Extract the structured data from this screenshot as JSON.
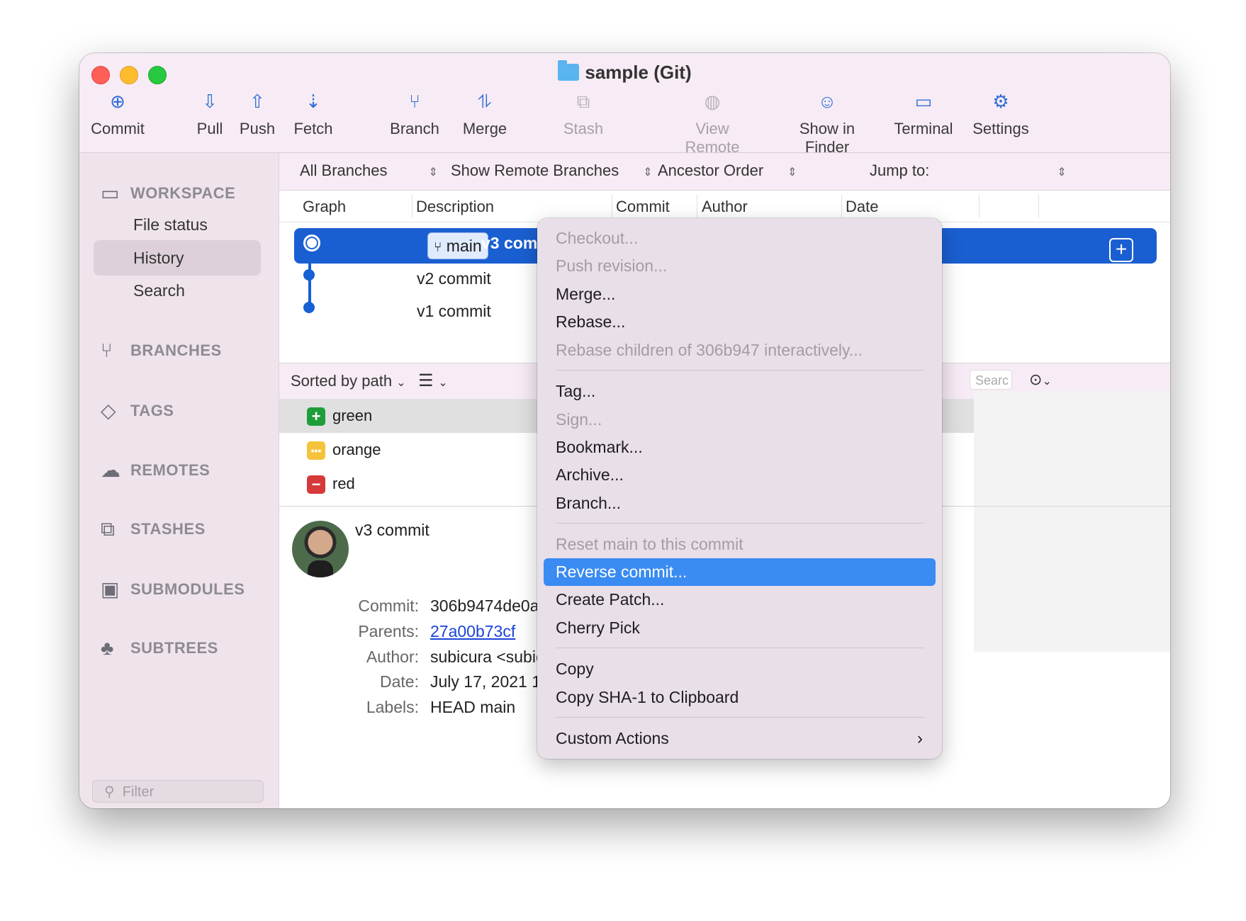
{
  "window": {
    "title": "sample (Git)"
  },
  "toolbar": {
    "commit": "Commit",
    "pull": "Pull",
    "push": "Push",
    "fetch": "Fetch",
    "branch": "Branch",
    "merge": "Merge",
    "stash": "Stash",
    "view_remote": "View Remote",
    "show_in_finder": "Show in Finder",
    "terminal": "Terminal",
    "settings": "Settings"
  },
  "sidebar": {
    "workspace": "WORKSPACE",
    "items": [
      "File status",
      "History",
      "Search"
    ],
    "branches": "BRANCHES",
    "tags": "TAGS",
    "remotes": "REMOTES",
    "stashes": "STASHES",
    "submodules": "SUBMODULES",
    "subtrees": "SUBTREES",
    "filter_placeholder": "Filter"
  },
  "filters": {
    "branches": "All Branches",
    "remote": "Show Remote Branches",
    "order": "Ancestor Order",
    "jump": "Jump to:"
  },
  "columns": [
    "Graph",
    "Description",
    "Commit",
    "Author",
    "Date"
  ],
  "commits": [
    {
      "branch": "main",
      "message": "v3 commit"
    },
    {
      "message": "v2 commit"
    },
    {
      "message": "v1 commit"
    }
  ],
  "sort": {
    "label": "Sorted by path",
    "search_placeholder": "Searc"
  },
  "files": [
    {
      "name": "green",
      "status": "added",
      "color": "#1f9d3a"
    },
    {
      "name": "orange",
      "status": "modified",
      "color": "#f5c33b"
    },
    {
      "name": "red",
      "status": "removed",
      "color": "#d6393a"
    }
  ],
  "details": {
    "message": "v3 commit",
    "labels": {
      "commit": "Commit:",
      "parents": "Parents:",
      "author": "Author:",
      "date": "Date:",
      "labels": "Labels:"
    },
    "values": {
      "commit": "306b9474de0af373",
      "parents": "27a00b73cf",
      "author": "subicura <subicura",
      "date": "July 17, 2021 12:55",
      "labels": "HEAD main"
    }
  },
  "context_menu": {
    "items": [
      {
        "label": "Checkout...",
        "enabled": false
      },
      {
        "label": "Push revision...",
        "enabled": false
      },
      {
        "label": "Merge...",
        "enabled": true
      },
      {
        "label": "Rebase...",
        "enabled": true
      },
      {
        "label": "Rebase children of 306b947 interactively...",
        "enabled": false
      },
      {
        "label": "Tag...",
        "enabled": true
      },
      {
        "label": "Sign...",
        "enabled": false
      },
      {
        "label": "Bookmark...",
        "enabled": true
      },
      {
        "label": "Archive...",
        "enabled": true
      },
      {
        "label": "Branch...",
        "enabled": true
      },
      {
        "label": "Reset main to this commit",
        "enabled": false
      },
      {
        "label": "Reverse commit...",
        "enabled": true,
        "highlighted": true
      },
      {
        "label": "Create Patch...",
        "enabled": true
      },
      {
        "label": "Cherry Pick",
        "enabled": true
      },
      {
        "label": "Copy",
        "enabled": true
      },
      {
        "label": "Copy SHA-1 to Clipboard",
        "enabled": true
      },
      {
        "label": "Custom Actions",
        "enabled": true,
        "submenu": true
      }
    ]
  },
  "colors": {
    "accent": "#1a5fd1",
    "menu_highlight": "#3a8bf2"
  }
}
